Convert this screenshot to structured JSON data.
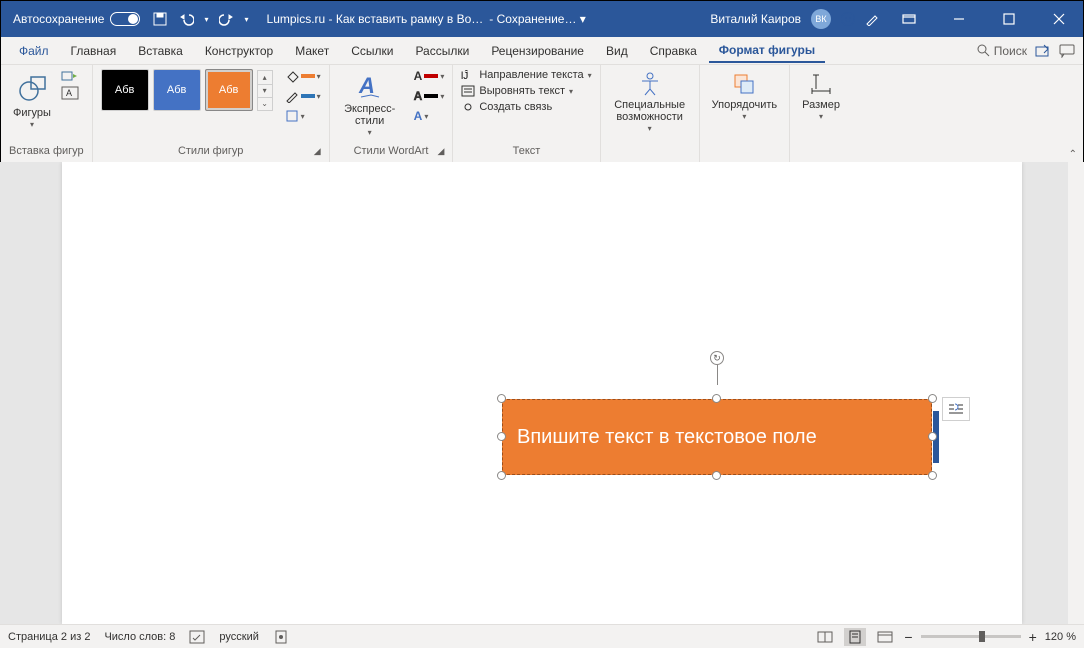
{
  "titlebar": {
    "autosave": "Автосохранение",
    "doc_title": "Lumpics.ru - Как вставить рамку в Во…",
    "saving": "Сохранение…",
    "username": "Виталий Каиров",
    "avatar": "ВК"
  },
  "tabs": {
    "file": "Файл",
    "items": [
      "Главная",
      "Вставка",
      "Конструктор",
      "Макет",
      "Ссылки",
      "Рассылки",
      "Рецензирование",
      "Вид",
      "Справка",
      "Формат фигуры"
    ],
    "active_index": 9,
    "search": "Поиск"
  },
  "ribbon": {
    "insert_shapes": {
      "btn": "Фигуры",
      "label": "Вставка фигур"
    },
    "shape_styles": {
      "sample": "Абв",
      "label": "Стили фигур"
    },
    "wordart": {
      "btn": "Экспресс-стили",
      "label": "Стили WordArt"
    },
    "text": {
      "direction": "Направление текста",
      "align": "Выровнять текст",
      "link": "Создать связь",
      "label": "Текст"
    },
    "accessibility": {
      "btn": "Специальные возможности"
    },
    "arrange": {
      "btn": "Упорядочить"
    },
    "size": {
      "btn": "Размер"
    }
  },
  "canvas": {
    "shape_text": "Впишите текст в текстовое поле"
  },
  "statusbar": {
    "page": "Страница 2 из 2",
    "words": "Число слов: 8",
    "lang": "русский",
    "zoom": "120 %"
  }
}
